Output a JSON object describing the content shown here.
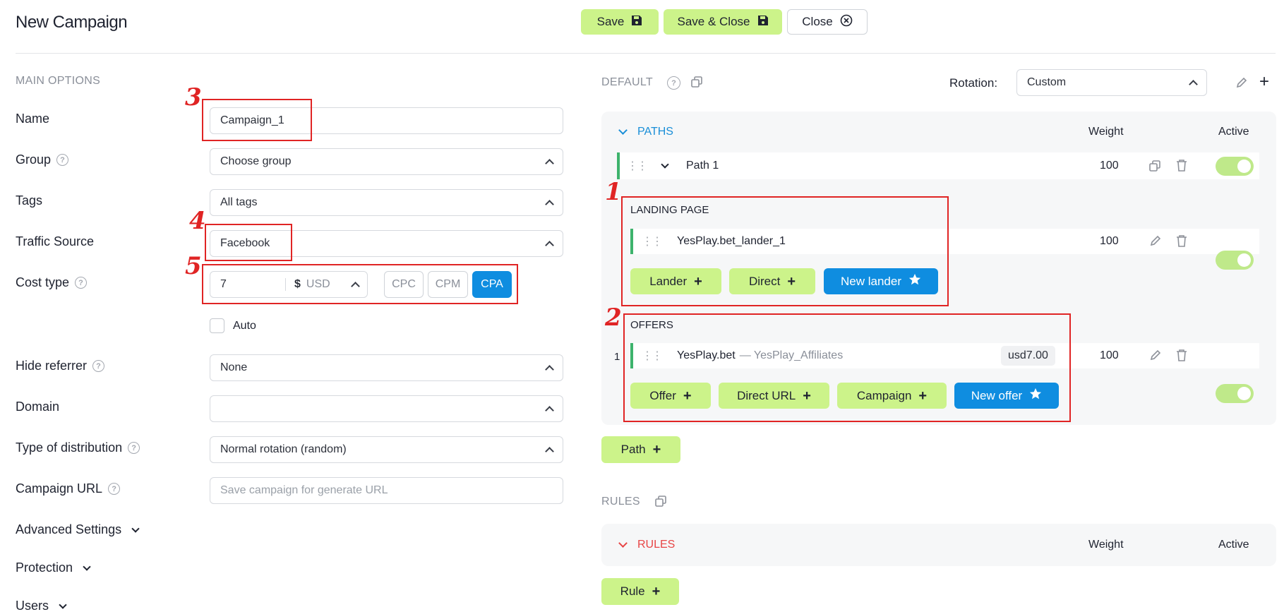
{
  "header": {
    "title": "New Campaign",
    "save": "Save",
    "save_close": "Save & Close",
    "close": "Close"
  },
  "main_options": {
    "section": "MAIN OPTIONS",
    "name_label": "Name",
    "name_value": "Campaign_1",
    "group_label": "Group",
    "group_value": "Choose group",
    "tags_label": "Tags",
    "tags_value": "All tags",
    "traffic_label": "Traffic Source",
    "traffic_value": "Facebook",
    "cost_label": "Cost type",
    "cost_value": "7",
    "currency_symbol": "$",
    "currency": "USD",
    "cost_types": [
      "CPC",
      "CPM",
      "CPA"
    ],
    "cost_selected": "CPA",
    "auto_label": "Auto",
    "hide_label": "Hide referrer",
    "hide_value": "None",
    "domain_label": "Domain",
    "domain_value": "",
    "dist_label": "Type of distribution",
    "dist_value": "Normal rotation (random)",
    "url_label": "Campaign URL",
    "url_placeholder": "Save campaign for generate URL",
    "advanced": "Advanced Settings",
    "protection": "Protection",
    "users": "Users"
  },
  "default_section": {
    "label": "DEFAULT",
    "rotation_label": "Rotation:",
    "rotation_value": "Custom",
    "paths_title": "PATHS",
    "weight": "Weight",
    "active": "Active",
    "path_name": "Path 1",
    "path_weight": "100",
    "landing_title": "LANDING PAGE",
    "lander_name": "YesPlay.bet_lander_1",
    "lander_weight": "100",
    "btn_lander": "Lander",
    "btn_direct": "Direct",
    "btn_new_lander": "New lander",
    "offers_title": "OFFERS",
    "offer_index": "1",
    "offer_name": "YesPlay.bet",
    "offer_network": "— YesPlay_Affiliates",
    "offer_payout": "usd7.00",
    "offer_weight": "100",
    "btn_offer": "Offer",
    "btn_direct_url": "Direct URL",
    "btn_campaign": "Campaign",
    "btn_new_offer": "New offer",
    "btn_path": "Path"
  },
  "rules_section": {
    "label": "RULES",
    "rules_title": "RULES",
    "weight": "Weight",
    "active": "Active",
    "btn_rule": "Rule"
  },
  "annotations": [
    "1",
    "2",
    "3",
    "4",
    "5"
  ],
  "colors": {
    "accent_green": "#ccf38a",
    "accent_blue": "#0f8de0",
    "annotation_red": "#e02424",
    "paths_blue": "#1a8fd8",
    "rules_red": "#e84545"
  }
}
